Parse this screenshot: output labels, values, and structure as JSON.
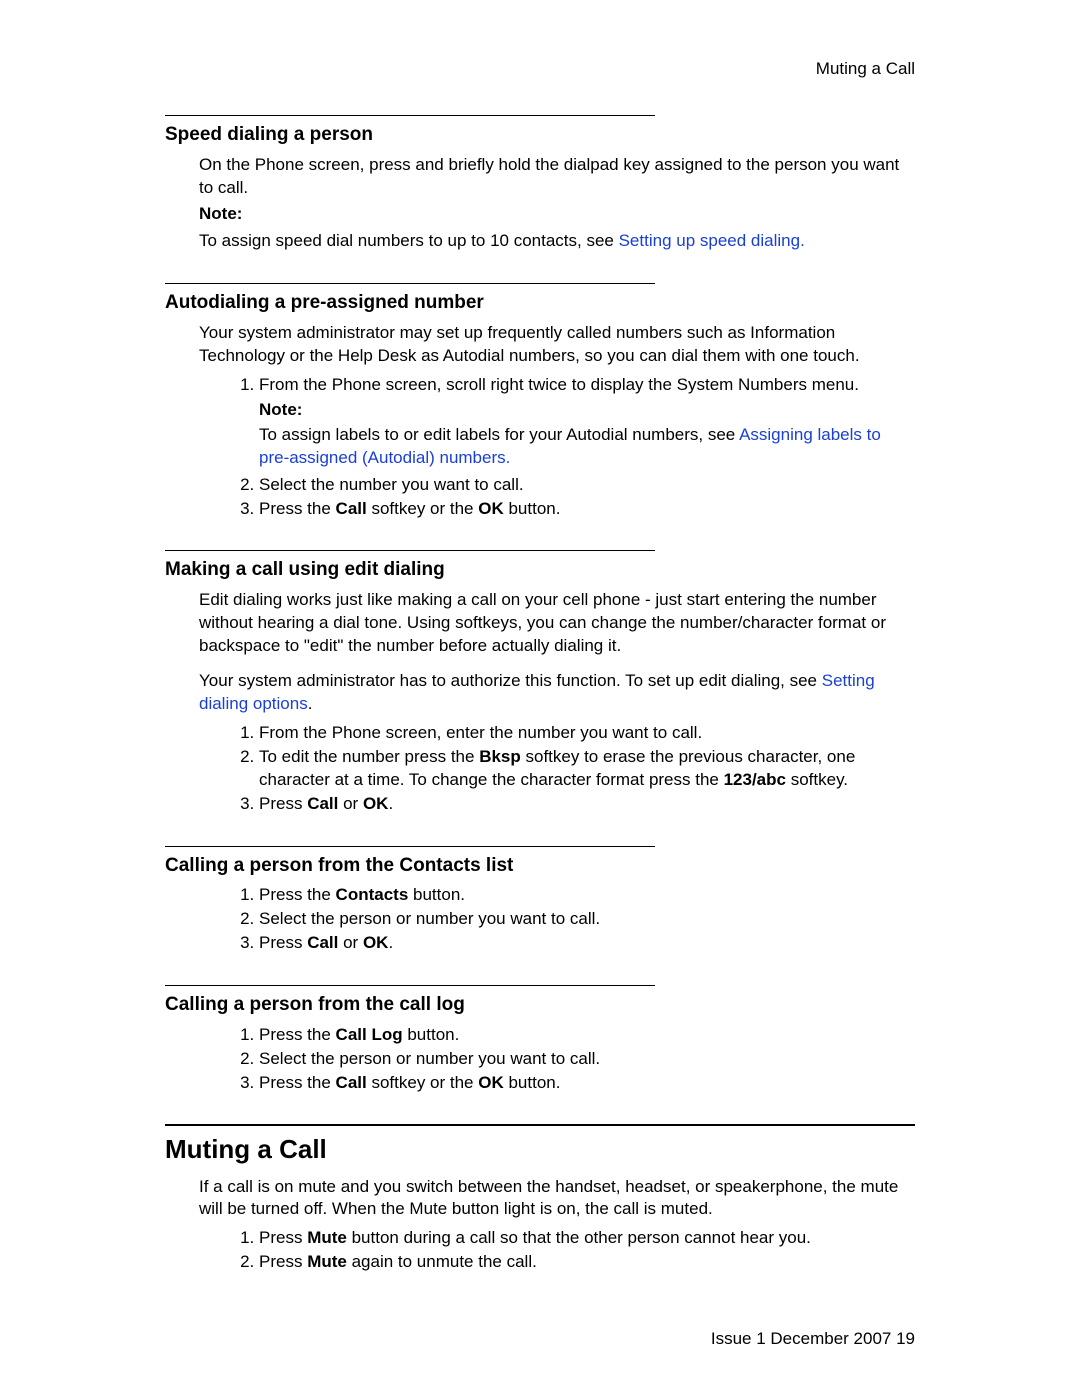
{
  "running_head": "Muting a Call",
  "footer": "Issue 1 December 2007 19",
  "sections": {
    "speed": {
      "title": "Speed dialing a person",
      "p1": "On the Phone screen, press and briefly hold the dialpad key assigned to the person you want to call.",
      "note_label": "Note:",
      "note_pre": "To assign speed dial numbers to up to 10 contacts, see ",
      "note_link": "Setting up speed dialing."
    },
    "autodial": {
      "title": "Autodialing a pre-assigned number",
      "p1": "Your system administrator may set up frequently called numbers such as Information Technology or the Help Desk as Autodial numbers, so you can dial them with one touch.",
      "step1": "From the Phone screen, scroll right twice to display the System Numbers menu.",
      "note_label": "Note:",
      "note_pre": "To assign labels to or edit labels for your Autodial numbers, see ",
      "note_link": "Assigning labels to pre-assigned (Autodial) numbers.",
      "step2": "Select the number you want to call.",
      "step3_a": "Press the ",
      "step3_b": "Call",
      "step3_c": " softkey or the ",
      "step3_d": "OK",
      "step3_e": " button."
    },
    "editdial": {
      "title": "Making a call using edit dialing",
      "p1": "Edit dialing works just like making a call on your cell phone - just start entering the number without hearing a dial tone. Using softkeys, you can change the number/character format or backspace to \"edit\" the number before actually dialing it.",
      "p2_a": "Your system administrator has to authorize this function. To set up edit dialing, see ",
      "p2_link": "Setting dialing options",
      "p2_c": ".",
      "step1": "From the Phone screen, enter the number you want to call.",
      "step2_a": "To edit the number press the ",
      "step2_b": "Bksp",
      "step2_c": " softkey to erase the previous character, one character at a time. To change the character format press the ",
      "step2_d": "123/abc",
      "step2_e": " softkey.",
      "step3_a": "Press ",
      "step3_b": "Call",
      "step3_c": " or ",
      "step3_d": "OK",
      "step3_e": "."
    },
    "contacts": {
      "title": "Calling a person from the Contacts list",
      "step1_a": "Press the ",
      "step1_b": "Contacts",
      "step1_c": " button.",
      "step2": "Select the person or number you want to call.",
      "step3_a": "Press ",
      "step3_b": "Call",
      "step3_c": " or ",
      "step3_d": "OK",
      "step3_e": "."
    },
    "calllog": {
      "title": "Calling a person from the call log",
      "step1_a": "Press the ",
      "step1_b": "Call Log",
      "step1_c": " button.",
      "step2": "Select the person or number you want to call.",
      "step3_a": "Press the ",
      "step3_b": "Call",
      "step3_c": " softkey or the ",
      "step3_d": "OK",
      "step3_e": " button."
    },
    "muting": {
      "title": "Muting a Call",
      "p1": "If a call is on mute and you switch between the handset, headset, or speakerphone, the mute will be turned off. When the Mute button light is on, the call is muted.",
      "step1_a": "Press ",
      "step1_b": "Mute",
      "step1_c": " button during a call so that the other person cannot hear you.",
      "step2_a": "Press ",
      "step2_b": "Mute",
      "step2_c": " again to unmute the call."
    }
  }
}
